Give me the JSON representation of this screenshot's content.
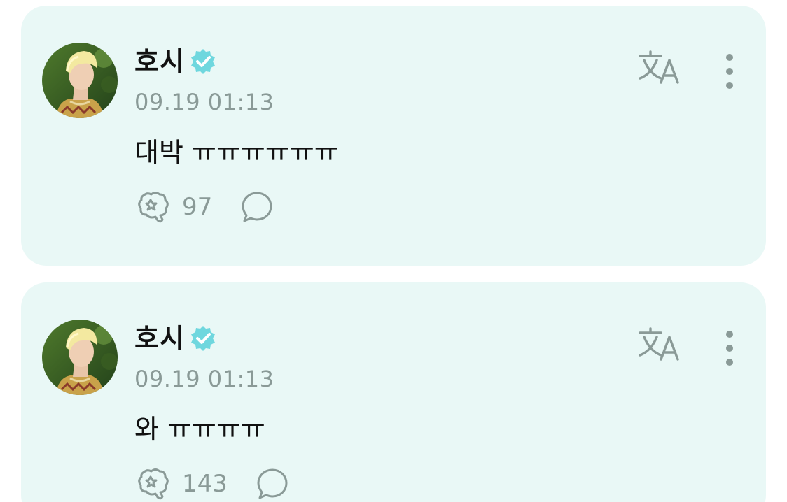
{
  "posts": [
    {
      "author": "호시",
      "verified": true,
      "timestamp": "09.19 01:13",
      "message": "대박 ㅠㅠㅠㅠㅠㅠ",
      "reaction_count": "97",
      "icons": {
        "verified": "verified-badge-icon",
        "translate": "translate-icon",
        "more": "more-vertical-icon",
        "reaction": "reaction-icon",
        "comment": "comment-icon"
      }
    },
    {
      "author": "호시",
      "verified": true,
      "timestamp": "09.19 01:13",
      "message": "와 ㅠㅠㅠㅠ",
      "reaction_count": "143",
      "icons": {
        "verified": "verified-badge-icon",
        "translate": "translate-icon",
        "more": "more-vertical-icon",
        "reaction": "reaction-icon",
        "comment": "comment-icon"
      }
    }
  ],
  "colors": {
    "card_background": "#e9f8f6",
    "verified_badge": "#6fd7de",
    "icon_gray": "#8a9a97",
    "text_primary": "#111111"
  }
}
